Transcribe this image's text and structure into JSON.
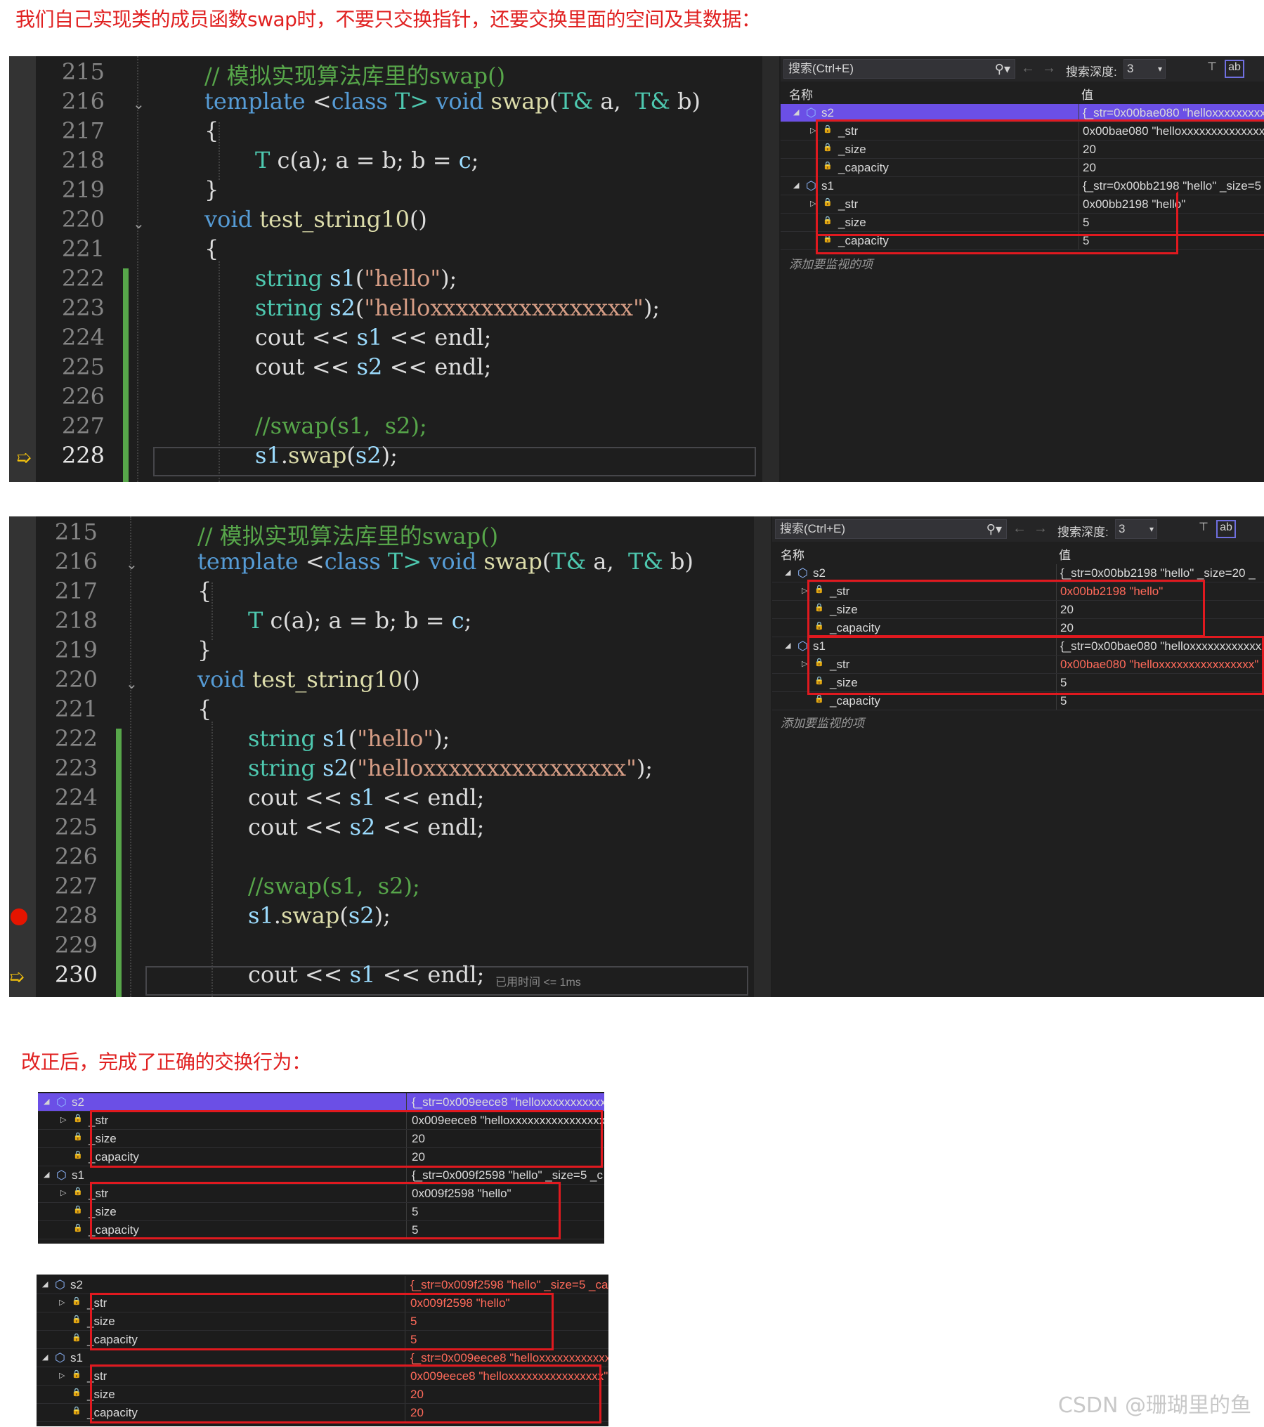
{
  "caption_top": "我们自己实现类的成员函数swap时，不要只交换指针，还要交换里面的空间及其数据：",
  "caption_mid": "改正后，完成了正确的交换行为：",
  "watermark": "CSDN @珊瑚里的鱼",
  "watch_ui": {
    "search_placeholder": "搜索(Ctrl+E)",
    "search_icon": "search-icon",
    "depth_label": "搜索深度:",
    "depth_value": "3",
    "col_name": "名称",
    "col_value": "值",
    "add_watch": "添加要监视的项"
  },
  "code": {
    "l215": "// 模拟实现算法库里的swap()",
    "l216a": "template",
    "l216b": " <",
    "l216c": "class",
    "l216d": " T> ",
    "l216e": "void",
    "l216f": " swap",
    "l216g": "(",
    "l216h": "T&",
    "l216i": " a,  ",
    "l216j": "T&",
    "l216k": " b)",
    "l217": "{",
    "l218a": "T",
    "l218b": " c(a); a = b; b = ",
    "l218c": "c",
    "l218d": ";",
    "l219": "}",
    "l220a": "void",
    "l220b": " test_string10",
    "l220c": "()",
    "l221": "{",
    "l222a": "string",
    "l222b": " s1",
    "l222c": "(",
    "l222d": "\"hello\"",
    "l222e": ");",
    "l223a": "string",
    "l223b": " s2",
    "l223c": "(",
    "l223d": "\"helloxxxxxxxxxxxxxxxx\"",
    "l223e": ");",
    "l224a": "cout",
    "l224b": " << ",
    "l224c": "s1",
    "l224d": " << ",
    "l224e": "endl",
    "l224f": ";",
    "l225a": "cout",
    "l225b": " << ",
    "l225c": "s2",
    "l225d": " << ",
    "l225e": "endl",
    "l225f": ";",
    "l227": "//swap(s1,  s2);",
    "l228a": "s1",
    "l228b": ".",
    "l228c": "swap",
    "l228d": "(",
    "l228e": "s2",
    "l228f": ");",
    "l230a": "cout",
    "l230b": " << ",
    "l230c": "s1",
    "l230d": " << ",
    "l230e": "endl",
    "l230f": ";",
    "timing": "已用时间 <= 1ms"
  },
  "lines1": [
    "215",
    "216",
    "217",
    "218",
    "219",
    "220",
    "221",
    "222",
    "223",
    "224",
    "225",
    "226",
    "227",
    "228"
  ],
  "lines2": [
    "215",
    "216",
    "217",
    "218",
    "219",
    "220",
    "221",
    "222",
    "223",
    "224",
    "225",
    "226",
    "227",
    "228",
    "229",
    "230"
  ],
  "watch1": [
    {
      "name": "s2",
      "value": "{_str=0x00bae080 \"helloxxxxxxxxxxxxxx",
      "level": 0,
      "sel": true
    },
    {
      "name": "_str",
      "value": "0x00bae080 \"helloxxxxxxxxxxxxxxxx\"",
      "level": 1
    },
    {
      "name": "_size",
      "value": "20",
      "level": 1
    },
    {
      "name": "_capacity",
      "value": "20",
      "level": 1
    },
    {
      "name": "s1",
      "value": "{_str=0x00bb2198 \"hello\" _size=5",
      "level": 0
    },
    {
      "name": "_str",
      "value": "0x00bb2198 \"hello\"",
      "level": 1
    },
    {
      "name": "_size",
      "value": "5",
      "level": 1
    },
    {
      "name": "_capacity",
      "value": "5",
      "level": 1
    }
  ],
  "watch2": [
    {
      "name": "s2",
      "value": "{_str=0x00bb2198 \"hello\" _size=20 _",
      "level": 0
    },
    {
      "name": "_str",
      "value": "0x00bb2198 \"hello\"",
      "level": 1,
      "red": true
    },
    {
      "name": "_size",
      "value": "20",
      "level": 1
    },
    {
      "name": "_capacity",
      "value": "20",
      "level": 1
    },
    {
      "name": "s1",
      "value": "{_str=0x00bae080 \"helloxxxxxxxxxxxxxx",
      "level": 0
    },
    {
      "name": "_str",
      "value": "0x00bae080 \"helloxxxxxxxxxxxxxxxx\"",
      "level": 1,
      "red": true
    },
    {
      "name": "_size",
      "value": "5",
      "level": 1
    },
    {
      "name": "_capacity",
      "value": "5",
      "level": 1
    }
  ],
  "mini1": [
    {
      "name": "s2",
      "value": "{_str=0x009eece8 \"helloxxxxxxxxxxxxxx",
      "level": 0,
      "sel": true
    },
    {
      "name": "_str",
      "value": "0x009eece8 \"helloxxxxxxxxxxxxxxxx\"",
      "level": 1
    },
    {
      "name": "_size",
      "value": "20",
      "level": 1
    },
    {
      "name": "_capacity",
      "value": "20",
      "level": 1
    },
    {
      "name": "s1",
      "value": "{_str=0x009f2598 \"hello\" _size=5 _c",
      "level": 0
    },
    {
      "name": "_str",
      "value": "0x009f2598 \"hello\"",
      "level": 1
    },
    {
      "name": "_size",
      "value": "5",
      "level": 1
    },
    {
      "name": "_capacity",
      "value": "5",
      "level": 1
    }
  ],
  "mini2": [
    {
      "name": "s2",
      "value": "{_str=0x009f2598 \"hello\" _size=5 _ca",
      "level": 0
    },
    {
      "name": "_str",
      "value": "0x009f2598 \"hello\"",
      "level": 1,
      "red": true
    },
    {
      "name": "_size",
      "value": "5",
      "level": 1,
      "red": true
    },
    {
      "name": "_capacity",
      "value": "5",
      "level": 1,
      "red": true
    },
    {
      "name": "s1",
      "value": "{_str=0x009eece8 \"helloxxxxxxxxxxxxxx",
      "level": 0
    },
    {
      "name": "_str",
      "value": "0x009eece8 \"helloxxxxxxxxxxxxxxxx\"",
      "level": 1,
      "red": true
    },
    {
      "name": "_size",
      "value": "20",
      "level": 1,
      "red": true
    },
    {
      "name": "_capacity",
      "value": "20",
      "level": 1,
      "red": true
    }
  ],
  "colors": {
    "accent": "#6b4fe6",
    "redbox": "#e0191f",
    "changed": "#57a64a",
    "breakpoint": "#e51400",
    "arrow": "#f4c20d"
  }
}
